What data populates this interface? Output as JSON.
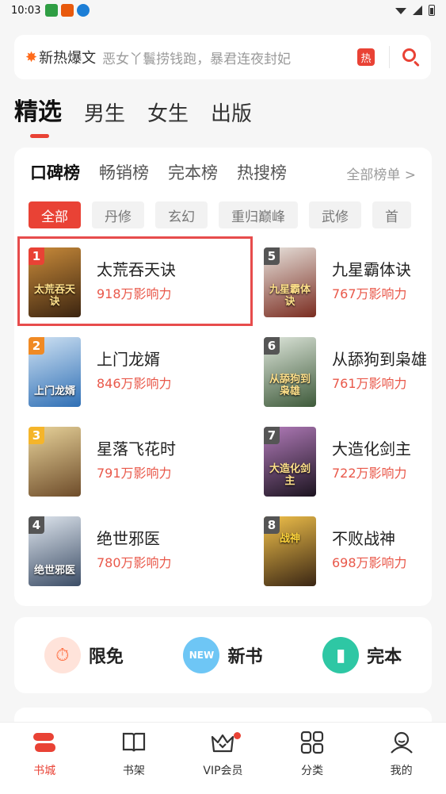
{
  "status_bar": {
    "time": "10:03"
  },
  "search": {
    "hot_label": "新热爆文",
    "hint": "恶女丫鬟捞钱跑，暴君连夜封妃",
    "hot_badge": "热"
  },
  "top_tabs": [
    {
      "label": "精选",
      "active": true
    },
    {
      "label": "男生",
      "active": false
    },
    {
      "label": "女生",
      "active": false
    },
    {
      "label": "出版",
      "active": false
    }
  ],
  "ranking": {
    "tabs": [
      {
        "label": "口碑榜",
        "active": true
      },
      {
        "label": "畅销榜",
        "active": false
      },
      {
        "label": "完本榜",
        "active": false
      },
      {
        "label": "热搜榜",
        "active": false
      }
    ],
    "all_ranks": "全部榜单 >",
    "filters": [
      {
        "label": "全部",
        "active": true
      },
      {
        "label": "丹修",
        "active": false
      },
      {
        "label": "玄幻",
        "active": false
      },
      {
        "label": "重归巅峰",
        "active": false
      },
      {
        "label": "武修",
        "active": false
      },
      {
        "label": "首",
        "active": false
      }
    ],
    "books": [
      {
        "rank": "1",
        "title": "太荒吞天诀",
        "impact": "918万影响力",
        "cover_text": "太荒吞天诀",
        "cover_color": "#6b4a1e"
      },
      {
        "rank": "2",
        "title": "上门龙婿",
        "impact": "846万影响力",
        "cover_text": "上门龙婿",
        "cover_color": "#3f78b8"
      },
      {
        "rank": "3",
        "title": "星落飞花时",
        "impact": "791万影响力",
        "cover_text": "",
        "cover_color": "#9a7a3a"
      },
      {
        "rank": "4",
        "title": "绝世邪医",
        "impact": "780万影响力",
        "cover_text": "绝世邪医",
        "cover_color": "#5a6c86"
      },
      {
        "rank": "5",
        "title": "九星霸体诀",
        "impact": "767万影响力",
        "cover_text": "九星霸体诀",
        "cover_color": "#7a2c20"
      },
      {
        "rank": "6",
        "title": "从舔狗到枭雄",
        "impact": "761万影响力",
        "cover_text": "从舔狗到枭雄",
        "cover_color": "#5f7a5a"
      },
      {
        "rank": "7",
        "title": "大造化剑主",
        "impact": "722万影响力",
        "cover_text": "大造化剑主",
        "cover_color": "#4b2f4e"
      },
      {
        "rank": "8",
        "title": "不败战神",
        "impact": "698万影响力",
        "cover_text": "战神",
        "cover_color": "#6b4422"
      }
    ]
  },
  "quick_links": [
    {
      "label": "限免",
      "icon": "stopwatch-icon",
      "color": "#ff8a65"
    },
    {
      "label": "新书",
      "icon": "new-tag-icon",
      "color": "#4fc3f7"
    },
    {
      "label": "完本",
      "icon": "book-complete-icon",
      "color": "#26c6a6"
    }
  ],
  "bottom_nav": [
    {
      "label": "书城",
      "icon": "bookstore-icon",
      "active": true
    },
    {
      "label": "书架",
      "icon": "bookshelf-icon",
      "active": false
    },
    {
      "label": "VIP会员",
      "icon": "crown-icon",
      "active": false,
      "badge_dot": true
    },
    {
      "label": "分类",
      "icon": "grid-icon",
      "active": false
    },
    {
      "label": "我的",
      "icon": "profile-icon",
      "active": false
    }
  ],
  "colors": {
    "accent": "#e94235",
    "impact_text": "#e9584a"
  }
}
